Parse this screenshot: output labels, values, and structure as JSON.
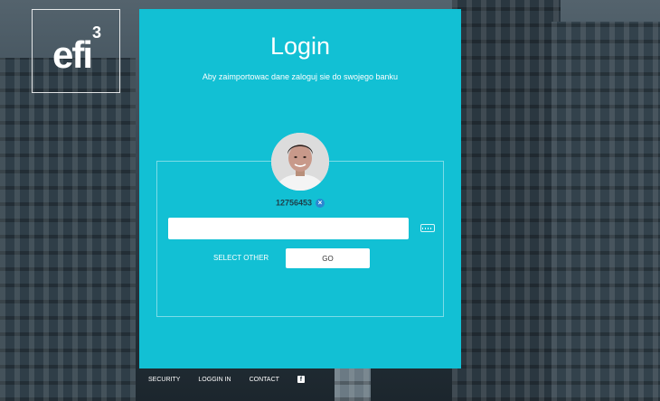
{
  "logo": {
    "text": "efi",
    "superscript": "3"
  },
  "login": {
    "title": "Login",
    "subtitle": "Aby zaimportowac dane zaloguj sie do swojego banku"
  },
  "account": {
    "username": "12756453",
    "clear_icon": "×"
  },
  "form": {
    "password_value": "",
    "select_other_label": "SELECT OTHER",
    "go_label": "GO"
  },
  "footer": {
    "links": [
      "SECURITY",
      "LOGGIN IN",
      "CONTACT"
    ],
    "social_icon": "f"
  },
  "colors": {
    "panel": "#12c0d4",
    "clear_button": "#2a86d1"
  },
  "icons": [
    "keyboard-icon",
    "facebook-icon",
    "close-icon"
  ]
}
